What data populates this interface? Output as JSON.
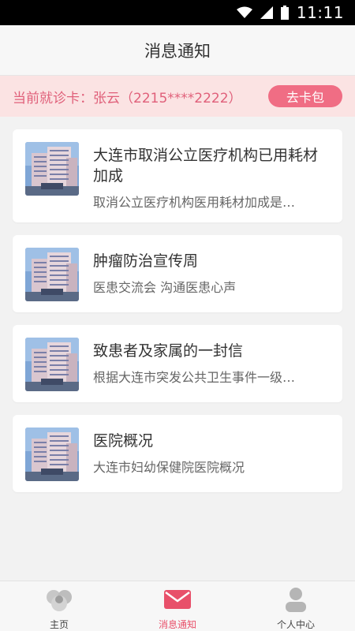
{
  "status_bar": {
    "time": "11:11"
  },
  "header": {
    "title": "消息通知"
  },
  "card_banner": {
    "text": "当前就诊卡：张云（2215****2222）",
    "button_label": "去卡包"
  },
  "messages": [
    {
      "title": "大连市取消公立医疗机构已用耗材加成",
      "desc": "取消公立医疗机构医用耗材加成是…"
    },
    {
      "title": "肿瘤防治宣传周",
      "desc": "医患交流会 沟通医患心声"
    },
    {
      "title": "致患者及家属的一封信",
      "desc": "根据大连市突发公共卫生事件一级…"
    },
    {
      "title": "医院概况",
      "desc": "大连市妇幼保健院医院概况"
    }
  ],
  "bottom_nav": {
    "items": [
      {
        "label": "主页",
        "icon": "home-logo-icon"
      },
      {
        "label": "消息通知",
        "icon": "mail-icon"
      },
      {
        "label": "个人中心",
        "icon": "person-icon"
      }
    ],
    "active_index": 1
  },
  "colors": {
    "accent": "#f06d84",
    "banner_bg": "#fbe3e3",
    "banner_text": "#e0607a"
  }
}
